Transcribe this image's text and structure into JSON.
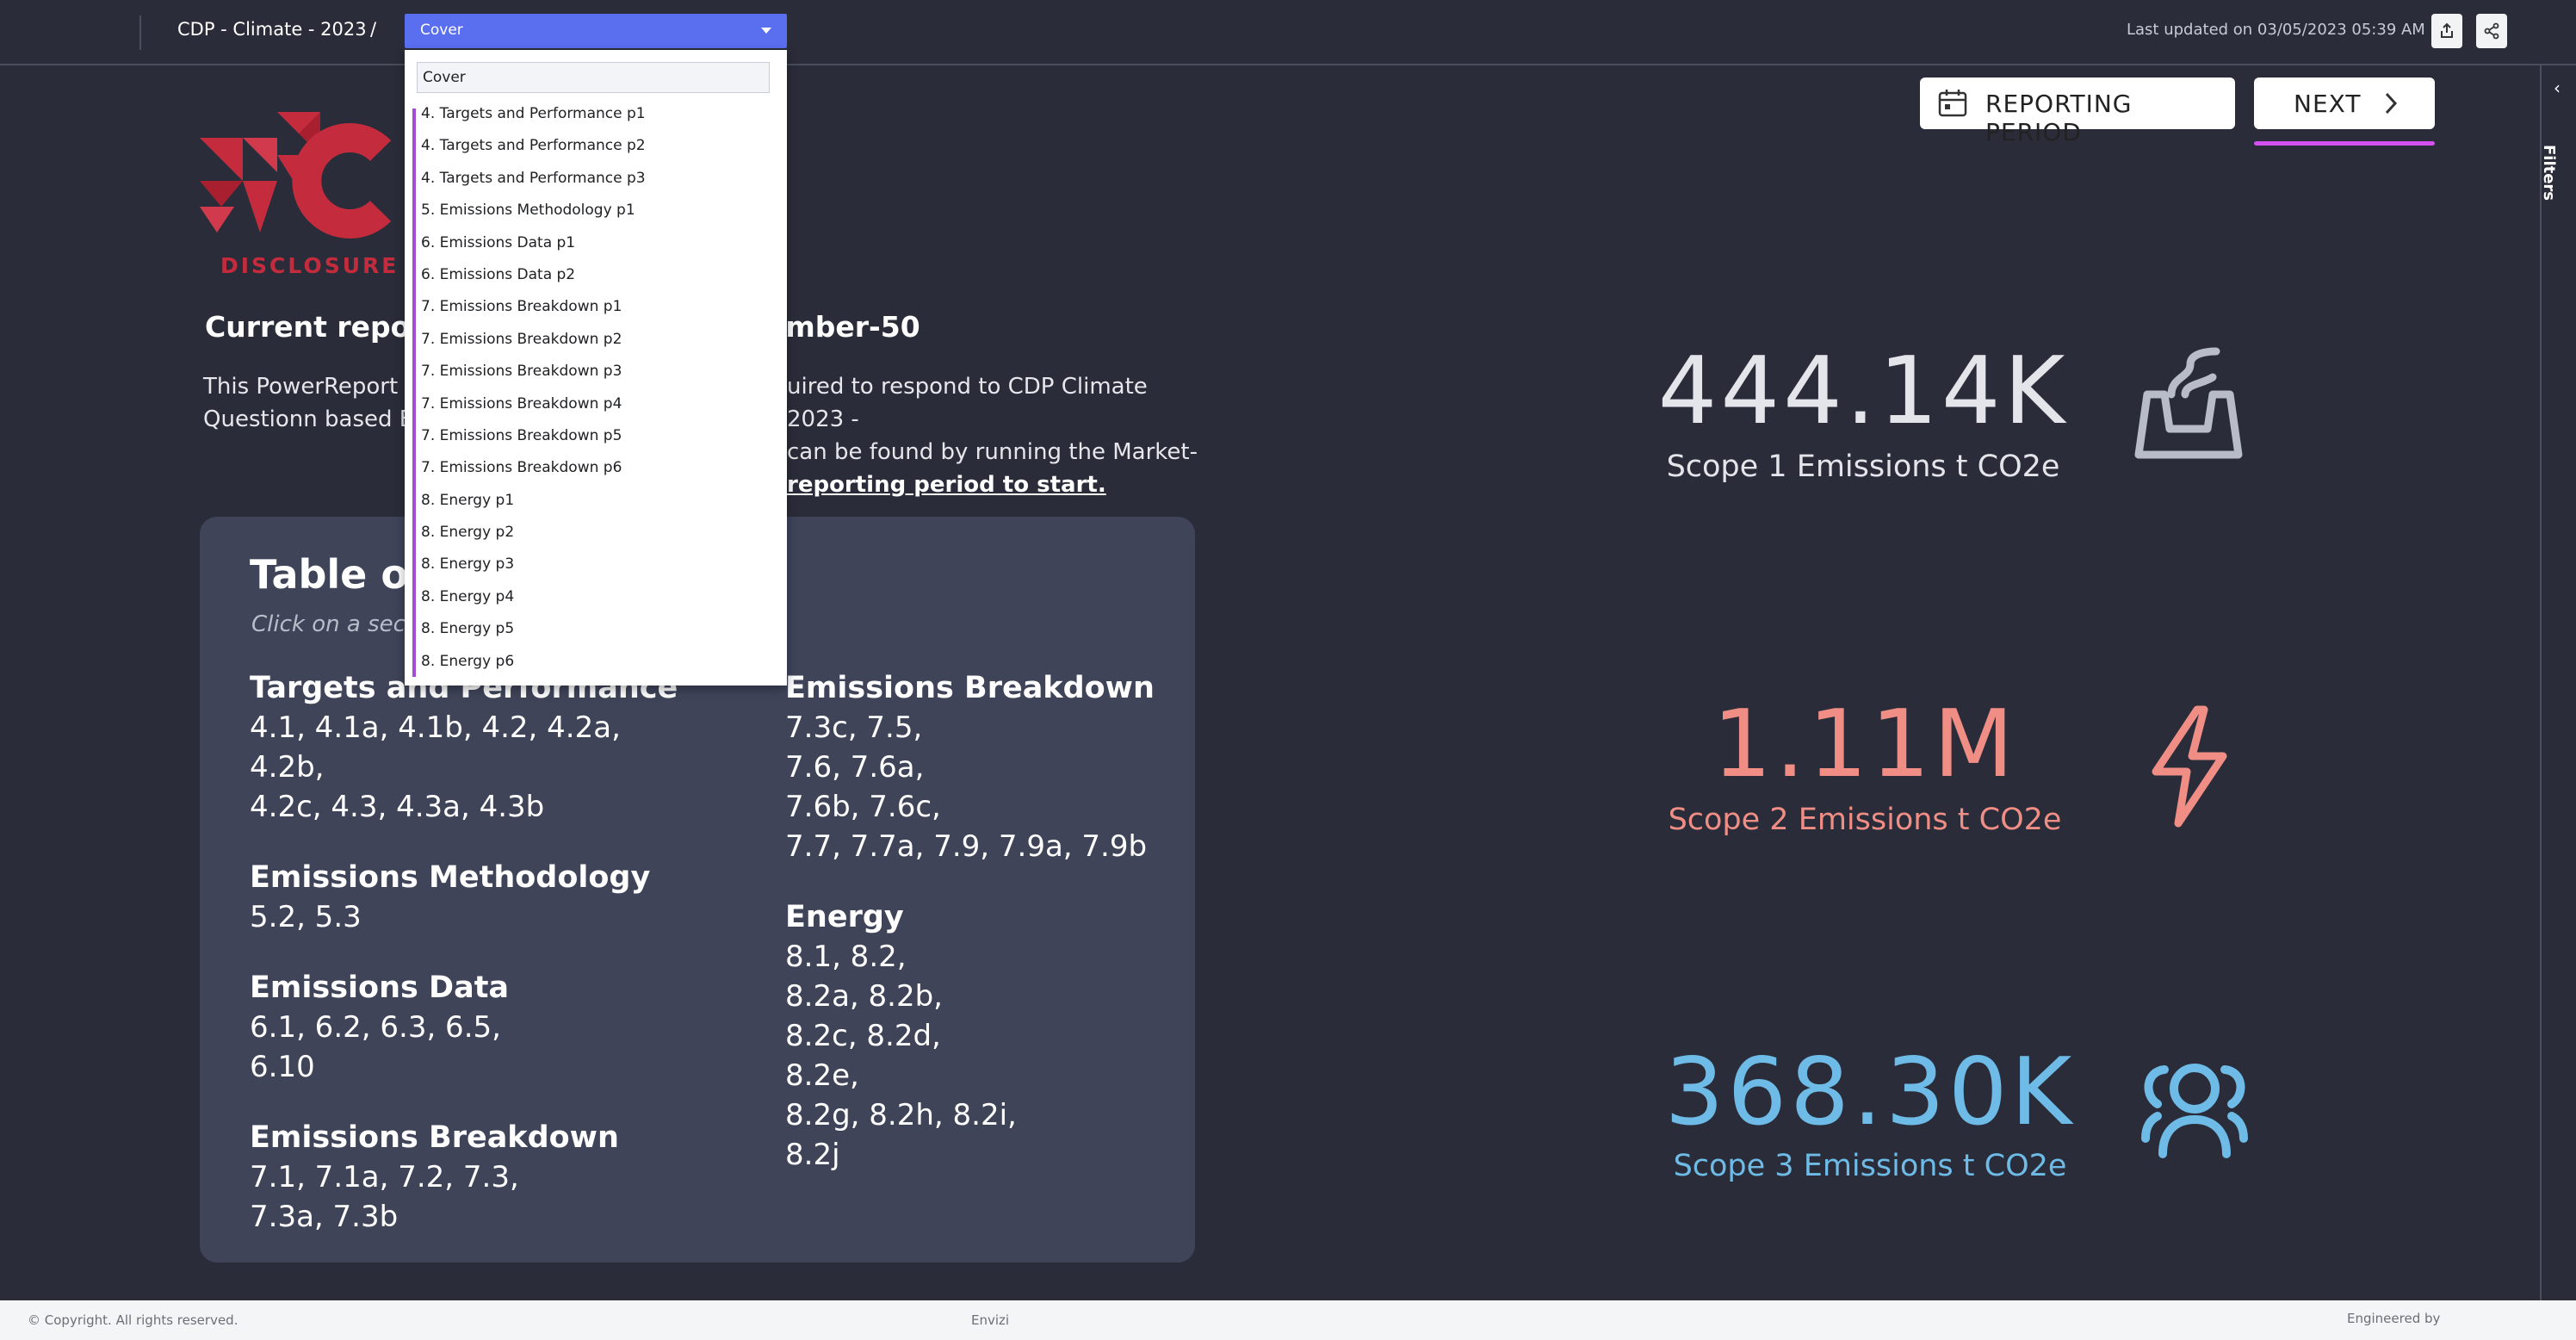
{
  "header": {
    "breadcrumb": "CDP - Climate - 2023",
    "separator": "/",
    "selected_page": "Cover",
    "last_updated": "Last updated on 03/05/2023 05:39 AM",
    "export_icon": "export-icon",
    "share_icon": "share-icon"
  },
  "dropdown": {
    "search_value": "Cover",
    "items": [
      "4. Targets and Performance p1",
      "4. Targets and Performance p2",
      "4. Targets and Performance p3",
      "5. Emissions Methodology p1",
      "6. Emissions Data p1",
      "6. Emissions Data p2",
      "7. Emissions Breakdown p1",
      "7. Emissions Breakdown p2",
      "7. Emissions Breakdown p3",
      "7. Emissions Breakdown p4",
      "7. Emissions Breakdown p5",
      "7. Emissions Breakdown p6",
      "8. Energy p1",
      "8. Energy p2",
      "8. Energy p3",
      "8. Energy p4",
      "8. Energy p5",
      "8. Energy p6"
    ]
  },
  "logo": {
    "text": "DISCLOSURE IN"
  },
  "main": {
    "current_period_left": "Current reporti",
    "current_period_right": "ember-50",
    "intro_left": "This PowerReport pr Standard Questionn based Emissions v2",
    "intro_right_line1": "uired to respond to CDP Climate 2023 -",
    "intro_right_line2": "can be found by running the Market-",
    "intro_right_link": "reporting period to start."
  },
  "toc": {
    "title": "Table of",
    "subtitle": "Click on a secti",
    "left_sections": [
      {
        "title": "Targets and Performance",
        "body": "4.1, 4.1a, 4.1b, 4.2, 4.2a, 4.2b,\n4.2c, 4.3, 4.3a, 4.3b"
      },
      {
        "title": "Emissions Methodology",
        "body": "5.2, 5.3"
      },
      {
        "title": "Emissions Data",
        "body": "6.1, 6.2, 6.3, 6.5,\n6.10"
      },
      {
        "title": "Emissions Breakdown",
        "body": "7.1, 7.1a, 7.2, 7.3,\n7.3a, 7.3b"
      }
    ],
    "right_sections": [
      {
        "title": "Emissions Breakdown",
        "body": "7.3c, 7.5,\n7.6, 7.6a,\n7.6b, 7.6c,\n7.7, 7.7a, 7.9, 7.9a, 7.9b"
      },
      {
        "title": "Energy",
        "body": "8.1, 8.2,\n8.2a, 8.2b,\n8.2c, 8.2d,\n8.2e,\n8.2g, 8.2h, 8.2i,\n8.2j"
      }
    ]
  },
  "buttons": {
    "reporting_period": "REPORTING PERIOD",
    "next": "NEXT"
  },
  "kpis": [
    {
      "value": "444.14K",
      "label": "Scope 1 Emissions t CO2e",
      "icon": "factory-icon",
      "color": "#e3e5ea"
    },
    {
      "value": "1.11M",
      "label": "Scope 2 Emissions t CO2e",
      "icon": "lightning-icon",
      "color": "#f08e86"
    },
    {
      "value": "368.30K",
      "label": "Scope 3 Emissions t CO2e",
      "icon": "people-icon",
      "color": "#6dbbe6"
    }
  ],
  "filters": {
    "label": "Filters",
    "collapse": "‹"
  },
  "footer": {
    "copyright": "© Copyright. All rights reserved.",
    "brand": "Envizi",
    "engineered_by": "Engineered by"
  }
}
